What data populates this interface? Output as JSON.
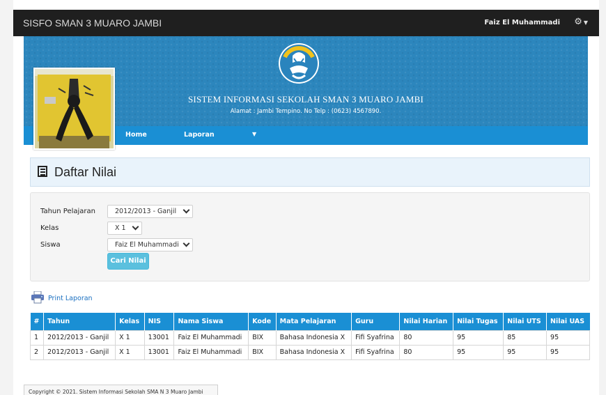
{
  "topbar": {
    "brand": "SISFO SMAN 3 MUARO JAMBI",
    "user_name": "Faiz El Muhammadi",
    "settings_icon": "gear-icon"
  },
  "banner": {
    "title": "SISTEM INFORMASI SEKOLAH SMAN 3 MUARO JAMBI",
    "address": "Alamat : Jambi Tempino. No Telp : (0623) 4567890."
  },
  "nav": {
    "items": [
      {
        "label": "Home"
      },
      {
        "label": "Laporan"
      }
    ]
  },
  "page": {
    "heading": "Daftar Nilai"
  },
  "form": {
    "tahun": {
      "label": "Tahun Pelajaran",
      "value": "2012/2013 - Ganjil"
    },
    "kelas": {
      "label": "Kelas",
      "value": "X 1"
    },
    "siswa": {
      "label": "Siswa",
      "value": "Faiz El Muhammadi"
    },
    "submit_label": "Cari Nilai"
  },
  "print": {
    "label": "Print Laporan"
  },
  "table": {
    "headers": [
      "#",
      "Tahun",
      "Kelas",
      "NIS",
      "Nama Siswa",
      "Kode",
      "Mata Pelajaran",
      "Guru",
      "Nilai Harian",
      "Nilai Tugas",
      "Nilai UTS",
      "Nilai UAS"
    ],
    "rows": [
      [
        "1",
        "2012/2013 - Ganjil",
        "X 1",
        "13001",
        "Faiz El Muhammadi",
        "BIX",
        "Bahasa Indonesia X",
        "Fifi Syafrina",
        "80",
        "95",
        "85",
        "95"
      ],
      [
        "2",
        "2012/2013 - Ganjil",
        "X 1",
        "13001",
        "Faiz El Muhammadi",
        "BIX",
        "Bahasa Indonesia X",
        "Fifi Syafrina",
        "80",
        "95",
        "95",
        "95"
      ]
    ]
  },
  "footer": {
    "text": "Copyright © 2021. Sistem Informasi Sekolah SMA N 3 Muaro Jambi"
  },
  "colors": {
    "topbar": "#1f1f1f",
    "nav": "#1a8fd4",
    "banner": "#2c86bd",
    "button": "#5bc0de"
  }
}
